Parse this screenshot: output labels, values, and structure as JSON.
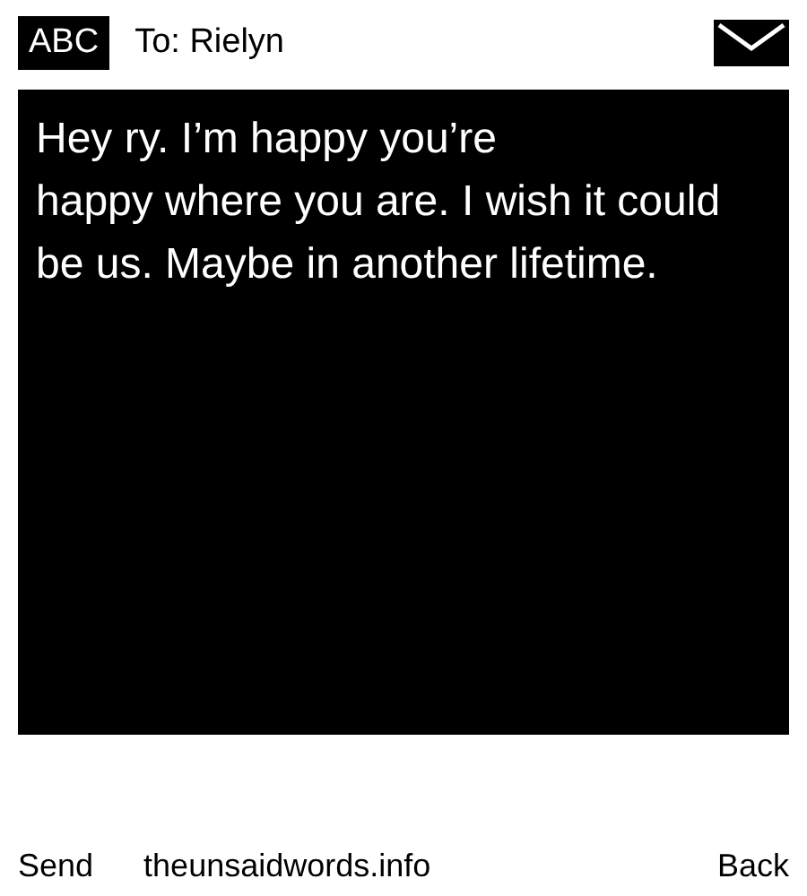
{
  "header": {
    "mode": "ABC",
    "recipient": "To: Rielyn"
  },
  "message": {
    "text": "Hey ry. I’m happy you’re\nhappy where you are. I wish it could be us. Maybe in another lifetime."
  },
  "footer": {
    "left": "Send",
    "center": "theunsaidwords.info",
    "right": "Back"
  }
}
